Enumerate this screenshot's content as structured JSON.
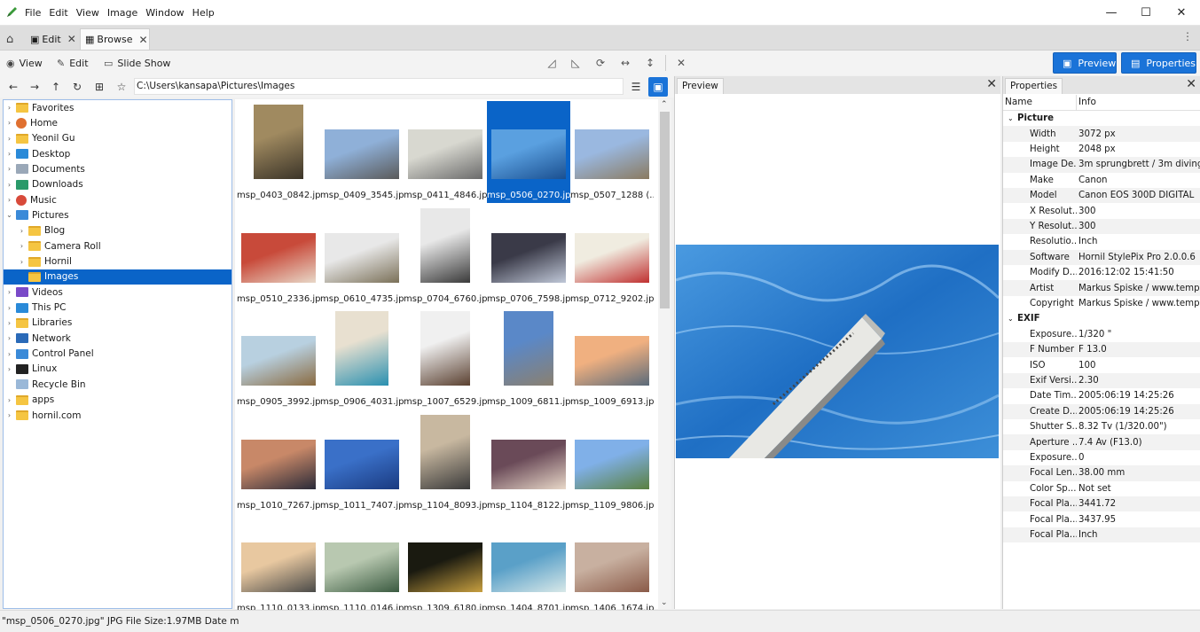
{
  "menu": [
    "File",
    "Edit",
    "View",
    "Image",
    "Window",
    "Help"
  ],
  "tabs": [
    {
      "label": "Edit"
    },
    {
      "label": "Browse"
    }
  ],
  "toolbar": {
    "view": "View",
    "edit": "Edit",
    "slideshow": "Slide Show",
    "preview": "Preview",
    "properties": "Properties"
  },
  "path": "C:\\Users\\kansapa\\Pictures\\Images",
  "tree": [
    {
      "label": "Favorites",
      "indent": 0,
      "icon": "folder",
      "chev": "›"
    },
    {
      "label": "Home",
      "indent": 0,
      "icon": "home",
      "chev": "›"
    },
    {
      "label": "Yeonil Gu",
      "indent": 0,
      "icon": "folder",
      "chev": "›"
    },
    {
      "label": "Desktop",
      "indent": 0,
      "icon": "desktop",
      "chev": "›"
    },
    {
      "label": "Documents",
      "indent": 0,
      "icon": "documents",
      "chev": "›"
    },
    {
      "label": "Downloads",
      "indent": 0,
      "icon": "downloads",
      "chev": "›"
    },
    {
      "label": "Music",
      "indent": 0,
      "icon": "music",
      "chev": "›"
    },
    {
      "label": "Pictures",
      "indent": 0,
      "icon": "pictures",
      "chev": "⌄"
    },
    {
      "label": "Blog",
      "indent": 1,
      "icon": "folder",
      "chev": "›"
    },
    {
      "label": "Camera Roll",
      "indent": 1,
      "icon": "folder",
      "chev": "›"
    },
    {
      "label": "Hornil",
      "indent": 1,
      "icon": "folder",
      "chev": "›"
    },
    {
      "label": "Images",
      "indent": 1,
      "icon": "folder",
      "chev": "",
      "selected": true
    },
    {
      "label": "Videos",
      "indent": 0,
      "icon": "videos",
      "chev": "›"
    },
    {
      "label": "This PC",
      "indent": 0,
      "icon": "pc",
      "chev": "›"
    },
    {
      "label": "Libraries",
      "indent": 0,
      "icon": "folder",
      "chev": "›"
    },
    {
      "label": "Network",
      "indent": 0,
      "icon": "network",
      "chev": "›"
    },
    {
      "label": "Control Panel",
      "indent": 0,
      "icon": "control",
      "chev": "›"
    },
    {
      "label": "Linux",
      "indent": 0,
      "icon": "linux",
      "chev": "›"
    },
    {
      "label": "Recycle Bin",
      "indent": 0,
      "icon": "recycle",
      "chev": ""
    },
    {
      "label": "apps",
      "indent": 0,
      "icon": "folder",
      "chev": "›"
    },
    {
      "label": "hornil.com",
      "indent": 0,
      "icon": "folder",
      "chev": "›"
    }
  ],
  "thumbs": [
    {
      "name": "msp_0403_0842.jpg",
      "w": 56,
      "h": 84,
      "c1": "#a08a60",
      "c2": "#3b3428"
    },
    {
      "name": "msp_0409_3545.jpg",
      "w": 84,
      "h": 56,
      "c1": "#8fb0d8",
      "c2": "#5a5a5a"
    },
    {
      "name": "msp_0411_4846.jpg",
      "w": 84,
      "h": 56,
      "c1": "#d8d8d0",
      "c2": "#6a6a6a"
    },
    {
      "name": "msp_0506_0270.jpg",
      "w": 84,
      "h": 56,
      "c1": "#5aa0e0",
      "c2": "#1a4f90",
      "selected": true
    },
    {
      "name": "msp_0507_1288 (...",
      "w": 84,
      "h": 56,
      "c1": "#9ab8e0",
      "c2": "#8a7a60"
    },
    {
      "name": "msp_0510_2336.jpg",
      "w": 84,
      "h": 56,
      "c1": "#c84a3a",
      "c2": "#e8d8c8"
    },
    {
      "name": "msp_0610_4735.jpg",
      "w": 84,
      "h": 56,
      "c1": "#e8e8e8",
      "c2": "#7a7058"
    },
    {
      "name": "msp_0704_6760.jpg",
      "w": 56,
      "h": 84,
      "c1": "#e8e8e8",
      "c2": "#3a3a3a"
    },
    {
      "name": "msp_0706_7598.jpg",
      "w": 84,
      "h": 56,
      "c1": "#3a3a48",
      "c2": "#c0c8d8"
    },
    {
      "name": "msp_0712_9202.jpg",
      "w": 84,
      "h": 56,
      "c1": "#f0ece0",
      "c2": "#c03030"
    },
    {
      "name": "msp_0905_3992.jpg",
      "w": 84,
      "h": 56,
      "c1": "#b8d0e0",
      "c2": "#8a6a40"
    },
    {
      "name": "msp_0906_4031.jpg",
      "w": 60,
      "h": 84,
      "c1": "#e8e0d0",
      "c2": "#2a90b0"
    },
    {
      "name": "msp_1007_6529.jpg",
      "w": 56,
      "h": 84,
      "c1": "#f0f0f0",
      "c2": "#5a4030"
    },
    {
      "name": "msp_1009_6811.jpg",
      "w": 56,
      "h": 84,
      "c1": "#5a88c8",
      "c2": "#8a8070"
    },
    {
      "name": "msp_1009_6913.jpg",
      "w": 84,
      "h": 56,
      "c1": "#f0b080",
      "c2": "#5a6a7a"
    },
    {
      "name": "msp_1010_7267.jpg",
      "w": 84,
      "h": 56,
      "c1": "#c88868",
      "c2": "#2a2a38"
    },
    {
      "name": "msp_1011_7407.jpg",
      "w": 84,
      "h": 56,
      "c1": "#3a70c8",
      "c2": "#1a3a80"
    },
    {
      "name": "msp_1104_8093.jpg",
      "w": 56,
      "h": 84,
      "c1": "#c8b8a0",
      "c2": "#3a3a3a"
    },
    {
      "name": "msp_1104_8122.jpg",
      "w": 84,
      "h": 56,
      "c1": "#6a4a58",
      "c2": "#e8d8c8"
    },
    {
      "name": "msp_1109_9806.jpg",
      "w": 84,
      "h": 56,
      "c1": "#80b0e8",
      "c2": "#5a8040"
    },
    {
      "name": "msp_1110_0133.jpg",
      "w": 84,
      "h": 56,
      "c1": "#e8c8a0",
      "c2": "#4a4a48"
    },
    {
      "name": "msp_1110_0146.jpg",
      "w": 84,
      "h": 56,
      "c1": "#b8c8b0",
      "c2": "#3a5a40"
    },
    {
      "name": "msp_1309_6180.jpg",
      "w": 84,
      "h": 56,
      "c1": "#1a1a10",
      "c2": "#c8a040"
    },
    {
      "name": "msp_1404_8701.jpg",
      "w": 84,
      "h": 56,
      "c1": "#5aa0c8",
      "c2": "#d8e8e8"
    },
    {
      "name": "msp_1406_1674.jpg",
      "w": 84,
      "h": 56,
      "c1": "#c8b0a0",
      "c2": "#8a5a48"
    }
  ],
  "preview": {
    "title": "Preview"
  },
  "properties": {
    "title": "Properties",
    "col_name": "Name",
    "col_info": "Info",
    "rows": [
      {
        "group": true,
        "name": "Picture"
      },
      {
        "name": "Width",
        "value": "3072 px"
      },
      {
        "name": "Height",
        "value": "2048 px"
      },
      {
        "name": "Image De...",
        "value": "3m sprungbrett / 3m diving b"
      },
      {
        "name": "Make",
        "value": "Canon"
      },
      {
        "name": "Model",
        "value": "Canon EOS 300D DIGITAL"
      },
      {
        "name": "X Resolut...",
        "value": "300"
      },
      {
        "name": "Y Resolut...",
        "value": "300"
      },
      {
        "name": "Resolutio...",
        "value": "Inch"
      },
      {
        "name": "Software",
        "value": "Hornil StylePix Pro 2.0.0.6"
      },
      {
        "name": "Modify D...",
        "value": "2016:12:02 15:41:50"
      },
      {
        "name": "Artist",
        "value": "Markus Spiske / www.tempora"
      },
      {
        "name": "Copyright",
        "value": "Markus Spiske / www.tempora"
      },
      {
        "group": true,
        "name": "EXIF"
      },
      {
        "name": "Exposure...",
        "value": "1/320 \""
      },
      {
        "name": "F Number",
        "value": "F 13.0"
      },
      {
        "name": "ISO",
        "value": "100"
      },
      {
        "name": "Exif Versi...",
        "value": "2.30"
      },
      {
        "name": "Date Tim...",
        "value": "2005:06:19 14:25:26"
      },
      {
        "name": "Create D...",
        "value": "2005:06:19 14:25:26"
      },
      {
        "name": "Shutter S...",
        "value": "8.32 Tv (1/320.00\")"
      },
      {
        "name": "Aperture ...",
        "value": "7.4 Av (F13.0)"
      },
      {
        "name": "Exposure...",
        "value": "0"
      },
      {
        "name": "Focal Len...",
        "value": "38.00 mm"
      },
      {
        "name": "Color Sp...",
        "value": "Not set"
      },
      {
        "name": "Focal Pla...",
        "value": "3441.72"
      },
      {
        "name": "Focal Pla...",
        "value": "3437.95"
      },
      {
        "name": "Focal Pla...",
        "value": "Inch"
      }
    ]
  },
  "status": "\"msp_0506_0270.jpg\" JPG File Size:1.97MB Date m"
}
